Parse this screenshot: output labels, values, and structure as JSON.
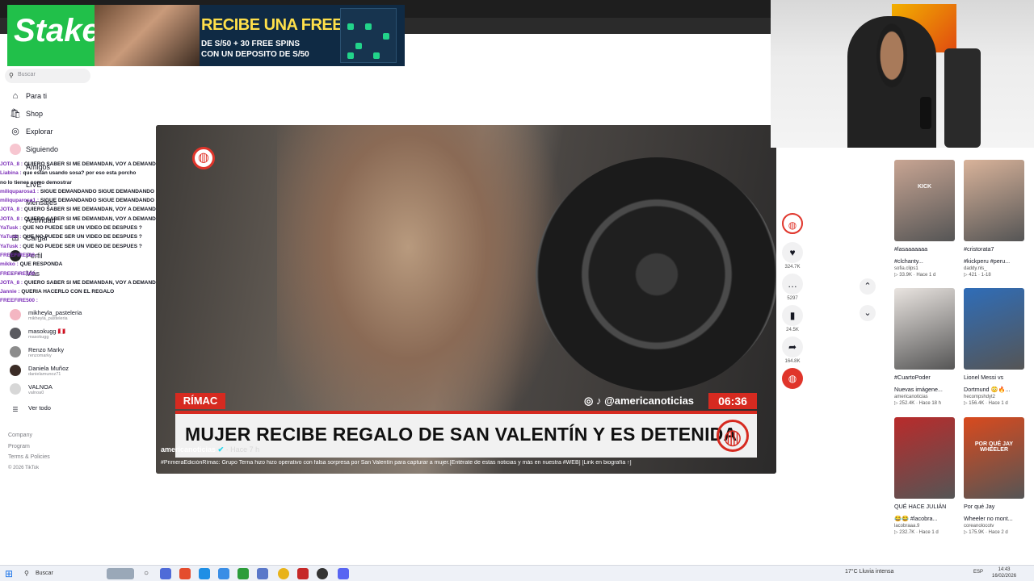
{
  "banner": {
    "brand": "Stake",
    "headline": "RECIBE UNA FREEBET",
    "sub_line1": "DE S/50 + 30 FREE SPINS",
    "sub_line2": "CON UN DEPOSITO DE S/50"
  },
  "search": {
    "placeholder": "Buscar"
  },
  "nav": {
    "for_you": "Para ti",
    "shop": "Shop",
    "explore": "Explorar",
    "following": "Siguiendo",
    "friends": "Amigos",
    "live": "LIVE",
    "messages": "Mensajes",
    "activity": "Actividad",
    "upload": "Cargar",
    "profile": "Perfil",
    "more": "Más"
  },
  "chat": [
    {
      "user": "JOTA_8 :",
      "text": "QUIERO SABER SI ME DEMANDAN, VOY A DEMANDAR CON EL BUTI;"
    },
    {
      "user": "Liabina :",
      "text": "que están usando sosa? por eso esta porcho"
    },
    {
      "user": "",
      "text": "no lo tienes como demostrar"
    },
    {
      "user": "miliquparosa1 :",
      "text": "SIGUE DEMANDANDO SIGUE DEMANDANDO SIGUE"
    },
    {
      "user": "miliquparosa1 :",
      "text": "SIGUE DEMANDANDO SIGUE DEMANDANDO"
    },
    {
      "user": "JOTA_8 :",
      "text": "QUIERO SABER SI ME DEMANDAN, VOY A DEMANDAR CON EL BUTI;"
    },
    {
      "user": "JOTA_8 :",
      "text": "QUIERO SABER SI ME DEMANDAN, VOY A DEMANDAR CON EL BUTI;"
    },
    {
      "user": "YaTusk :",
      "text": "QUE NO PUEDE SER UN VIDEO DE DESPUES ?"
    },
    {
      "user": "YaTusk :",
      "text": "QUE NO PUEDE SER UN VIDEO DE DESPUES ?"
    },
    {
      "user": "YaTusk :",
      "text": "QUE NO PUEDE SER UN VIDEO DE DESPUES ?"
    },
    {
      "user": "FREEFIRE500 :",
      "text": ""
    },
    {
      "user": "mikko :",
      "text": "QUE RESPONDA"
    },
    {
      "user": "FREEFIRE500 :",
      "text": ""
    },
    {
      "user": "JOTA_8 :",
      "text": "QUIERO SABER SI ME DEMANDAN, VOY A DEMANDAR CON EL BUTI;"
    },
    {
      "user": "Jannie :",
      "text": "QUERIA HACERLO CON EL REGALO"
    },
    {
      "user": "FREEFIRE500 :",
      "text": ""
    }
  ],
  "following_accounts": [
    {
      "name": "mikheyla_pasteleria",
      "handle": "mikheyla_pasteleria"
    },
    {
      "name": "masokugg 🇵🇪",
      "handle": "masokugg"
    },
    {
      "name": "Renzo Marky",
      "handle": "renzomarky"
    },
    {
      "name": "Daniela Muñoz",
      "handle": "danielamunoz71"
    },
    {
      "name": "VALNOA",
      "handle": "valnoa0"
    }
  ],
  "see_all": "Ver todo",
  "footer": {
    "company": "Company",
    "program": "Program",
    "terms": "Terms & Policies",
    "copyright": "© 2026 TikTok"
  },
  "video": {
    "channel_tag": "RÍMAC",
    "social_handle": "@americanoticias",
    "clock": "06:36",
    "headline": "MUJER RECIBE REGALO DE SAN VALENTÍN Y ES DETENIDA",
    "author": "americanoticias",
    "posted": "· Hace 7 h",
    "caption": "#PrimeraEdiciónRímac: Grupo Terna hizo hizo operativo con falsa sorpresa por San Valentín para capturar a mujer.[Entérate de estas noticias y más en nuestra #WEB] [Link en biografía ↑]"
  },
  "actions": {
    "likes": "324.7K",
    "comments": "5297",
    "saves": "24.5K",
    "shares": "164.8K"
  },
  "grid": [
    {
      "title": "#lasaaaaaaa",
      "title2": "#clchanty...",
      "user": "sofia.clips1",
      "views": "33.9K",
      "age": "Hace 1 d",
      "thumb_color": "#c8a593",
      "overlay": "KICK"
    },
    {
      "title": "#cristorata7",
      "title2": "#kickperu #peru...",
      "user": "daddy.nls_",
      "views": "421",
      "age": "1-18",
      "thumb_color": "#d9b39a",
      "overlay": ""
    },
    {
      "title": "#CuartoPoder",
      "title2": "Nuevas imágene...",
      "user": "americanoticias",
      "views": "252.4K",
      "age": "Hace 18 h",
      "thumb_color": "#e9e4e0",
      "overlay": ""
    },
    {
      "title": "Lionel Messi vs",
      "title2": "Dortmund 😳🔥...",
      "user": "hecompshdyt2",
      "views": "156.4K",
      "age": "Hace 1 d",
      "thumb_color": "#2f6db8",
      "overlay": ""
    },
    {
      "title": "QUÉ HACE JULIÁN",
      "title2": "😂😂 #lacobra...",
      "user": "lacobraaa.9",
      "views": "232.7K",
      "age": "Hace 1 d",
      "thumb_color": "#b92b2b",
      "overlay": ""
    },
    {
      "title": "Por qué Jay",
      "title2": "Wheeler no mont...",
      "user": "coreanolocotv",
      "views": "175.9K",
      "age": "Hace 2 d",
      "thumb_color": "#d94a1e",
      "overlay": "POR QUÉ JAY WHEELER"
    }
  ],
  "taskbar": {
    "search": "Buscar",
    "weather": "17°C  Lluvia intensa",
    "lang": "ESP",
    "time": "14:43",
    "date": "16/02/2026"
  },
  "colors": {
    "accent_red": "#d62a20",
    "stake_green": "#21c04a",
    "verified": "#20d5ec"
  }
}
